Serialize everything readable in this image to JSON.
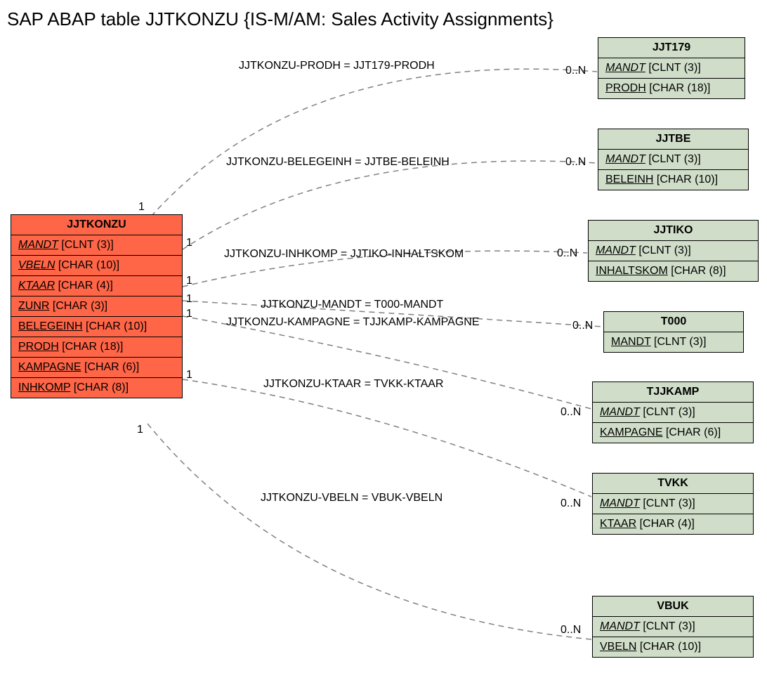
{
  "title": "SAP ABAP table JJTKONZU {IS-M/AM: Sales Activity Assignments}",
  "main": {
    "name": "JJTKONZU",
    "fields": [
      {
        "name": "MANDT",
        "type": "[CLNT (3)]",
        "key": true
      },
      {
        "name": "VBELN",
        "type": "[CHAR (10)]",
        "key": true
      },
      {
        "name": "KTAAR",
        "type": "[CHAR (4)]",
        "key": true
      },
      {
        "name": "ZUNR",
        "type": "[CHAR (3)]",
        "key": false
      },
      {
        "name": "BELEGEINH",
        "type": "[CHAR (10)]",
        "key": false
      },
      {
        "name": "PRODH",
        "type": "[CHAR (18)]",
        "key": false
      },
      {
        "name": "KAMPAGNE",
        "type": "[CHAR (6)]",
        "key": false
      },
      {
        "name": "INHKOMP",
        "type": "[CHAR (8)]",
        "key": false
      }
    ]
  },
  "refs": [
    {
      "name": "JJT179",
      "fields": [
        {
          "name": "MANDT",
          "type": "[CLNT (3)]",
          "key": true
        },
        {
          "name": "PRODH",
          "type": "[CHAR (18)]",
          "key": false
        }
      ]
    },
    {
      "name": "JJTBE",
      "fields": [
        {
          "name": "MANDT",
          "type": "[CLNT (3)]",
          "key": true
        },
        {
          "name": "BELEINH",
          "type": "[CHAR (10)]",
          "key": false
        }
      ]
    },
    {
      "name": "JJTIKO",
      "fields": [
        {
          "name": "MANDT",
          "type": "[CLNT (3)]",
          "key": true
        },
        {
          "name": "INHALTSKOM",
          "type": "[CHAR (8)]",
          "key": false
        }
      ]
    },
    {
      "name": "T000",
      "fields": [
        {
          "name": "MANDT",
          "type": "[CLNT (3)]",
          "key": false
        }
      ]
    },
    {
      "name": "TJJKAMP",
      "fields": [
        {
          "name": "MANDT",
          "type": "[CLNT (3)]",
          "key": true
        },
        {
          "name": "KAMPAGNE",
          "type": "[CHAR (6)]",
          "key": false
        }
      ]
    },
    {
      "name": "TVKK",
      "fields": [
        {
          "name": "MANDT",
          "type": "[CLNT (3)]",
          "key": true
        },
        {
          "name": "KTAAR",
          "type": "[CHAR (4)]",
          "key": false
        }
      ]
    },
    {
      "name": "VBUK",
      "fields": [
        {
          "name": "MANDT",
          "type": "[CLNT (3)]",
          "key": true
        },
        {
          "name": "VBELN",
          "type": "[CHAR (10)]",
          "key": false
        }
      ]
    }
  ],
  "edges": [
    {
      "label": "JJTKONZU-PRODH = JJT179-PRODH",
      "left": "1",
      "right": "0..N"
    },
    {
      "label": "JJTKONZU-BELEGEINH = JJTBE-BELEINH",
      "left": "1",
      "right": "0..N"
    },
    {
      "label": "JJTKONZU-INHKOMP = JJTIKO-INHALTSKOM",
      "left": "1",
      "right": "0..N"
    },
    {
      "label": "JJTKONZU-MANDT = T000-MANDT",
      "left": "1",
      "right": "0..N"
    },
    {
      "label": "JJTKONZU-KAMPAGNE = TJJKAMP-KAMPAGNE",
      "left": "1",
      "right": ""
    },
    {
      "label": "JJTKONZU-KTAAR = TVKK-KTAAR",
      "left": "1",
      "right": "0..N"
    },
    {
      "label": "JJTKONZU-VBELN = VBUK-VBELN",
      "left": "1",
      "right": "0..N"
    }
  ]
}
